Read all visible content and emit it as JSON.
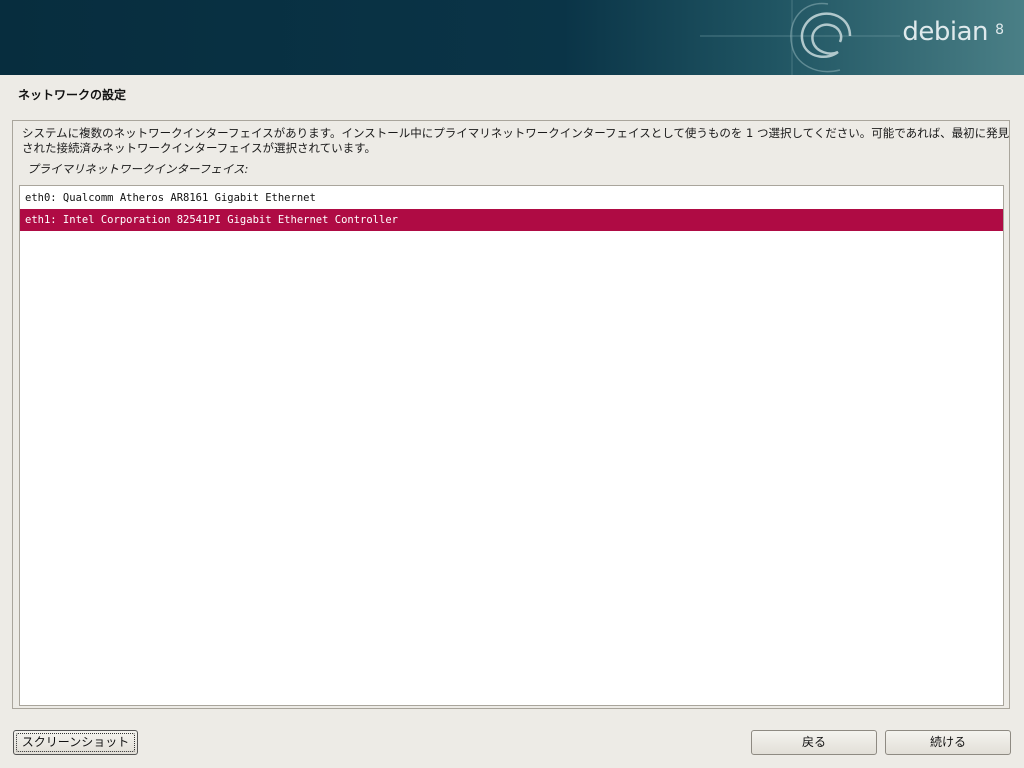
{
  "header": {
    "brand": "debian",
    "version": "8"
  },
  "page": {
    "title": "ネットワークの設定",
    "description": "システムに複数のネットワークインターフェイスがあります。インストール中にプライマリネットワークインターフェイスとして使うものを 1 つ選択してください。可能であれば、最初に発見された接続済みネットワークインターフェイスが選択されています。",
    "list_label": "プライマリネットワークインターフェイス:"
  },
  "interfaces": [
    {
      "label": "eth0: Qualcomm Atheros AR8161 Gigabit Ethernet",
      "selected": false
    },
    {
      "label": "eth1: Intel Corporation 82541PI Gigabit Ethernet Controller",
      "selected": true
    }
  ],
  "buttons": {
    "screenshot": "スクリーンショット",
    "back": "戻る",
    "continue": "続ける"
  },
  "colors": {
    "selection": "#af0b44",
    "banner": "#0a3447",
    "background": "#edebe6"
  }
}
